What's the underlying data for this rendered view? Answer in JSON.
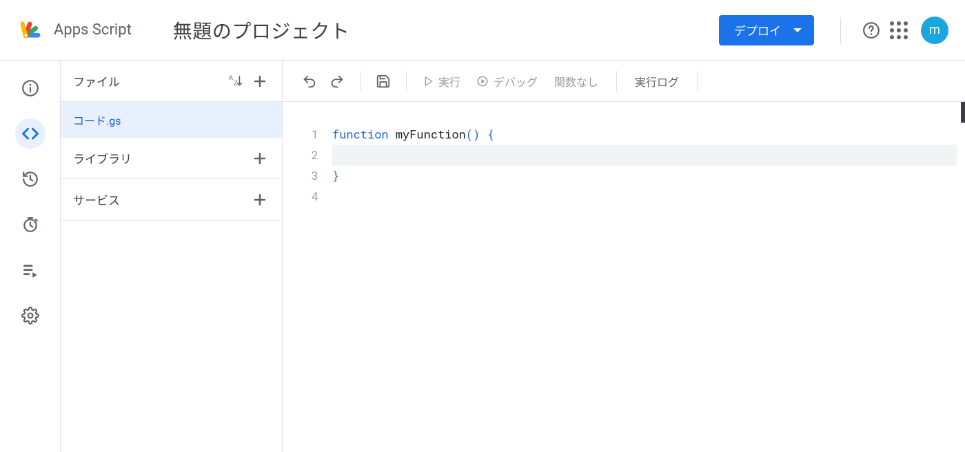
{
  "header": {
    "product_name": "Apps Script",
    "project_title": "無題のプロジェクト",
    "deploy_label": "デプロイ",
    "avatar_initial": "m"
  },
  "rail": {
    "items": [
      "overview",
      "editor",
      "triggers",
      "executions",
      "project-settings"
    ]
  },
  "file_panel": {
    "files_label": "ファイル",
    "library_label": "ライブラリ",
    "services_label": "サービス",
    "files": [
      {
        "name": "コード.gs",
        "active": true
      }
    ]
  },
  "toolbar": {
    "run_label": "実行",
    "debug_label": "デバッグ",
    "function_select": "関数なし",
    "log_label": "実行ログ"
  },
  "editor": {
    "lines": [
      {
        "n": 1,
        "tokens": [
          [
            "kw",
            "function"
          ],
          [
            "sp",
            " "
          ],
          [
            "fn",
            "myFunction"
          ],
          [
            "paren",
            "()"
          ],
          [
            "sp",
            " "
          ],
          [
            "brace",
            "{"
          ]
        ]
      },
      {
        "n": 2,
        "tokens": [
          [
            "sp",
            "  "
          ]
        ],
        "current": true
      },
      {
        "n": 3,
        "tokens": [
          [
            "brace",
            "}"
          ]
        ]
      },
      {
        "n": 4,
        "tokens": []
      }
    ]
  }
}
